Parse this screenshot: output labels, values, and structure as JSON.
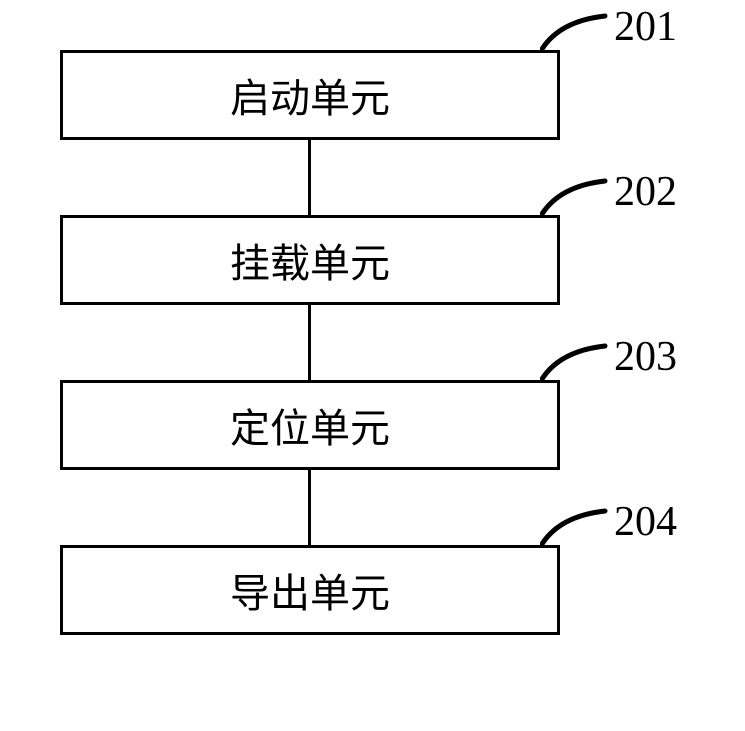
{
  "blocks": [
    {
      "label": "启动单元",
      "number": "201"
    },
    {
      "label": "挂载单元",
      "number": "202"
    },
    {
      "label": "定位单元",
      "number": "203"
    },
    {
      "label": "导出单元",
      "number": "204"
    }
  ]
}
